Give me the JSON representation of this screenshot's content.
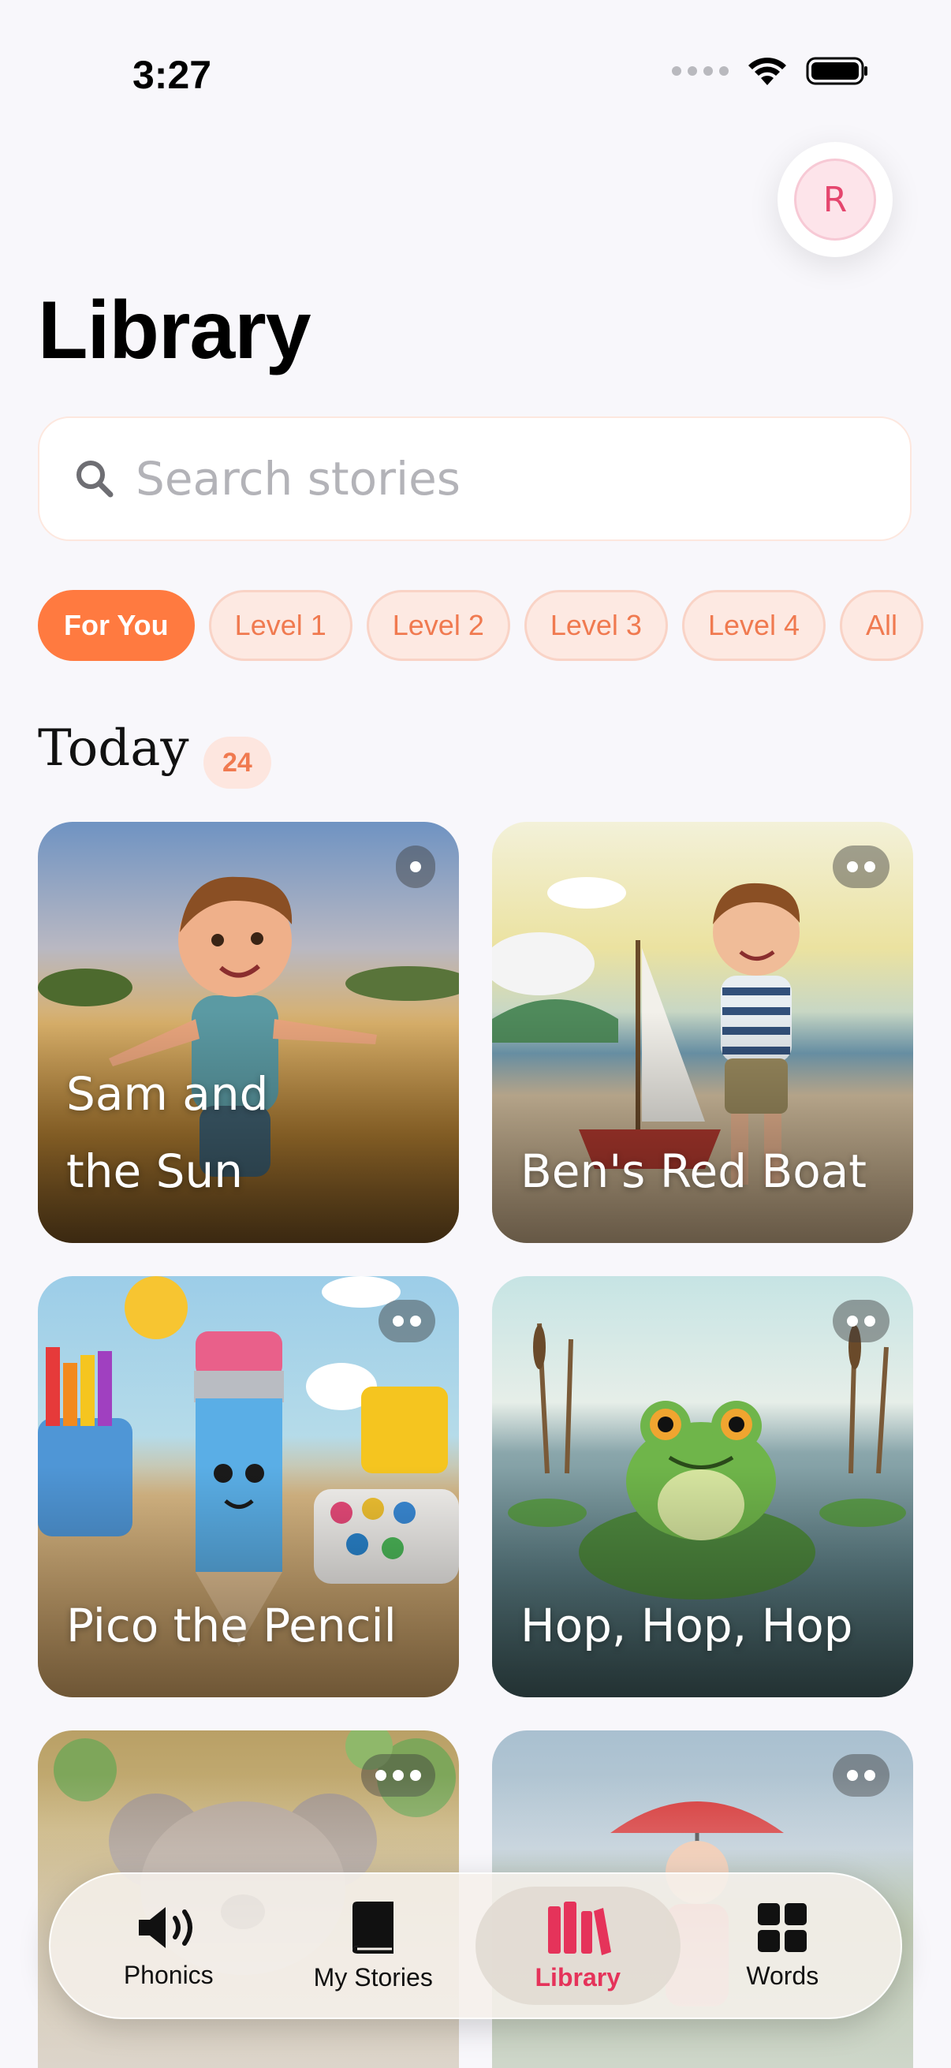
{
  "status": {
    "time": "3:27"
  },
  "header": {
    "avatar_initial": "R",
    "title": "Library"
  },
  "search": {
    "placeholder": "Search stories"
  },
  "filters": [
    "For You",
    "Level 1",
    "Level 2",
    "Level 3",
    "Level 4",
    "All"
  ],
  "active_filter": "For You",
  "section": {
    "title": "Today",
    "count": "24"
  },
  "stories": [
    {
      "title": "Sam and the Sun",
      "level_dots": 1
    },
    {
      "title": "Ben's Red Boat",
      "level_dots": 2
    },
    {
      "title": "Pico the Pencil",
      "level_dots": 2
    },
    {
      "title": "Hop, Hop, Hop",
      "level_dots": 2
    },
    {
      "title": "",
      "level_dots": 3
    },
    {
      "title": "",
      "level_dots": 2
    }
  ],
  "tabs": [
    {
      "label": "Phonics",
      "icon": "speaker-icon"
    },
    {
      "label": "My Stories",
      "icon": "book-icon"
    },
    {
      "label": "Library",
      "icon": "books-icon"
    },
    {
      "label": "Words",
      "icon": "grid-icon"
    }
  ],
  "active_tab": "Library",
  "colors": {
    "accent": "#ff7a40",
    "active_tab": "#e5335a",
    "background": "#f8f7fb"
  }
}
